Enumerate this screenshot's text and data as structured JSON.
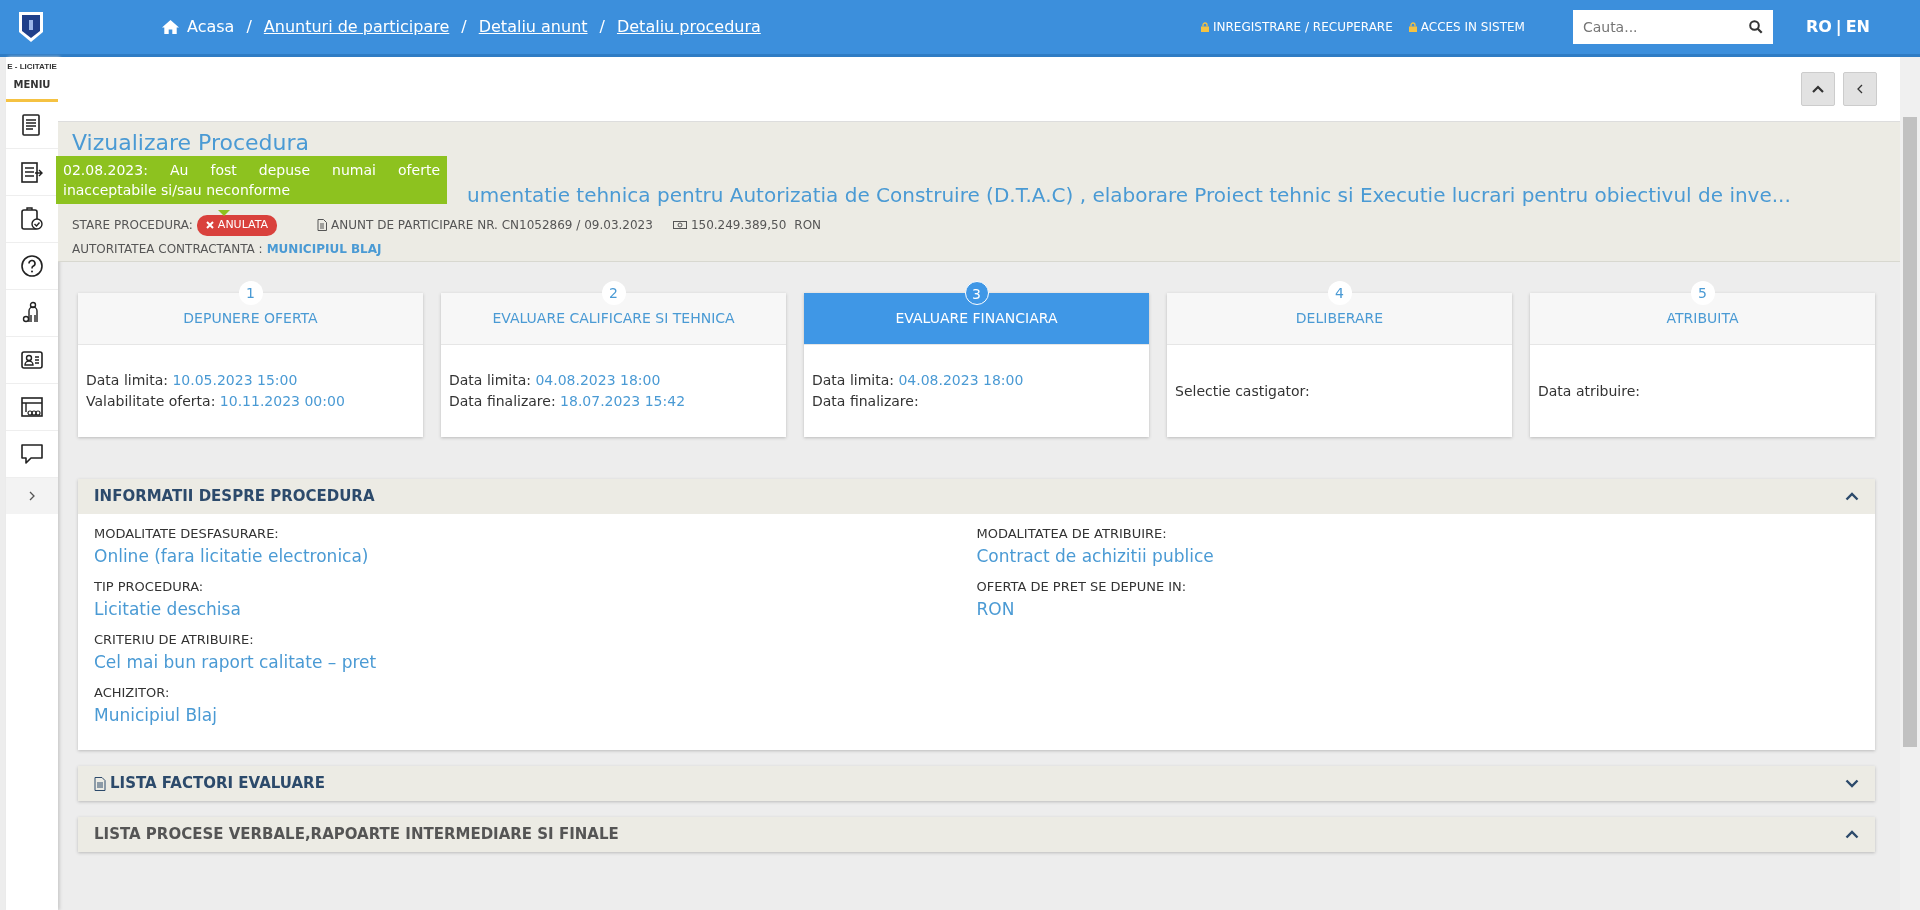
{
  "topbar": {
    "breadcrumb": [
      {
        "label": "Acasa",
        "kind": "home"
      },
      {
        "label": "Anunturi de participare",
        "kind": "link"
      },
      {
        "label": "Detaliu anunt",
        "kind": "link"
      },
      {
        "label": "Detaliu procedura",
        "kind": "link"
      }
    ],
    "separator": "/",
    "account_links": [
      "INREGISTRARE / RECUPERARE",
      "ACCES IN SISTEM"
    ],
    "search": {
      "placeholder": "Cauta..."
    },
    "languages": [
      "RO",
      "EN"
    ],
    "language_separator": "|"
  },
  "sidebar": {
    "brand": "E - LICITATIE",
    "menu_label": "MENIU"
  },
  "header": {
    "title": "Vizualizare Procedura",
    "notice": "02.08.2023: Au fost depuse numai oferte inacceptabile si/sau neconforme",
    "procedure_title": "umentatie tehnica pentru Autorizatia de Construire (D.T.A.C) , elaborare Proiect tehnic si Executie lucrari pentru obiectivul de inve...",
    "status_label": "STARE PROCEDURA:",
    "status": "ANULATA",
    "announcement": "ANUNT DE PARTICIPARE NR. CN1052869 / 09.03.2023",
    "value": "150.249.389,50",
    "currency": "RON",
    "authority_label": "AUTORITATEA CONTRACTANTA :",
    "authority": "MUNICIPIUL BLAJ"
  },
  "steps": [
    {
      "number": "1",
      "title": "DEPUNERE OFERTA",
      "selected": false,
      "lines": [
        {
          "label": "Data limita:",
          "value": "10.05.2023 15:00"
        },
        {
          "label": "Valabilitate oferta:",
          "value": "10.11.2023 00:00"
        }
      ]
    },
    {
      "number": "2",
      "title": "EVALUARE CALIFICARE SI TEHNICA",
      "selected": false,
      "lines": [
        {
          "label": "Data limita:",
          "value": "04.08.2023 18:00"
        },
        {
          "label": "Data finalizare:",
          "value": "18.07.2023 15:42"
        }
      ]
    },
    {
      "number": "3",
      "title": "EVALUARE FINANCIARA",
      "selected": true,
      "lines": [
        {
          "label": "Data limita:",
          "value": "04.08.2023 18:00"
        },
        {
          "label": "Data finalizare:"
        }
      ]
    },
    {
      "number": "4",
      "title": "DELIBERARE",
      "selected": false,
      "lines": [
        {
          "label": "Selectie castigator:"
        }
      ]
    },
    {
      "number": "5",
      "title": "ATRIBUITA",
      "selected": false,
      "lines": [
        {
          "label": "Data atribuire:"
        }
      ]
    }
  ],
  "info": {
    "title": "INFORMATII DESPRE PROCEDURA",
    "expanded": true,
    "columns": [
      [
        {
          "label": "MODALITATE DESFASURARE:",
          "value": "Online (fara licitatie electronica)"
        },
        {
          "label": "TIP PROCEDURA:",
          "value": "Licitatie deschisa"
        },
        {
          "label": "CRITERIU DE ATRIBUIRE:",
          "value": "Cel mai bun raport calitate – pret"
        },
        {
          "label": "ACHIZITOR:",
          "value": "Municipiul Blaj"
        }
      ],
      [
        {
          "label": "MODALITATEA DE ATRIBUIRE:",
          "value": "Contract de achizitii publice"
        },
        {
          "label": "OFERTA DE PRET SE DEPUNE IN:",
          "value": "RON"
        }
      ]
    ]
  },
  "panels": [
    {
      "title": "LISTA FACTORI EVALUARE",
      "kind": "document",
      "expanded": false
    },
    {
      "title": "LISTA PROCESE VERBALE,RAPOARTE INTERMEDIARE SI FINALE",
      "kind": "plain",
      "expanded": true
    }
  ]
}
